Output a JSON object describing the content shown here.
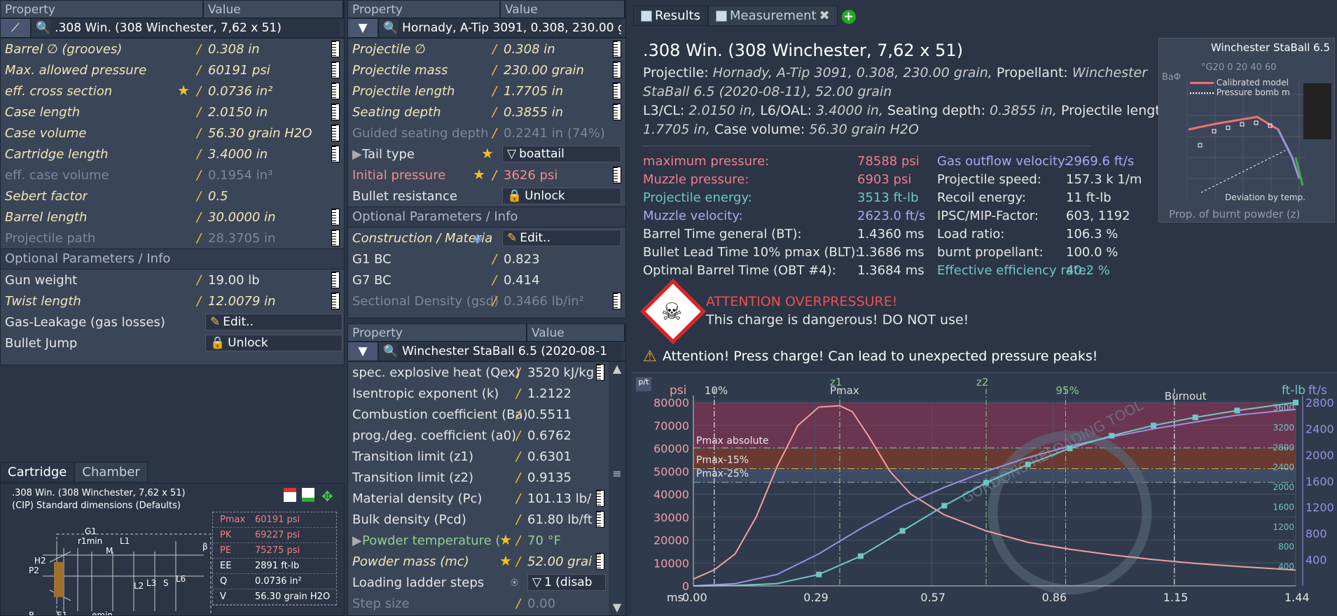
{
  "panel1": {
    "col_property": "Property",
    "col_value": "Value",
    "selector": ".308 Win. (308 Winchester, 7,62 x 51)",
    "rows": [
      {
        "k": "Barrel ∅ (grooves)",
        "v": "0.308 in"
      },
      {
        "k": "Max. allowed pressure",
        "v": "60191 psi"
      },
      {
        "k": "eff. cross section",
        "v": "0.0736 in²"
      },
      {
        "k": "Case length",
        "v": "2.0150 in"
      },
      {
        "k": "Case volume",
        "v": "56.30 grain H2O"
      },
      {
        "k": "Cartridge length",
        "v": "3.4000 in"
      },
      {
        "k": "eff. case volume",
        "v": "0.1954 in³"
      },
      {
        "k": "Sebert factor",
        "v": "0.5"
      },
      {
        "k": "Barrel length",
        "v": "30.0000 in"
      },
      {
        "k": "Projectile path",
        "v": "28.3705 in"
      }
    ],
    "section": "Optional Parameters / Info",
    "opt_rows": [
      {
        "k": "Gun weight",
        "v": "19.00 lb"
      },
      {
        "k": "Twist length",
        "v": "12.0079 in"
      },
      {
        "k": "Gas-Leakage (gas losses)",
        "v": "Edit.."
      },
      {
        "k": "Bullet Jump",
        "v": "Unlock"
      }
    ]
  },
  "cartridge": {
    "tab1": "Cartridge",
    "tab2": "Chamber",
    "line1": ".308 Win. (308 Winchester, 7,62 x 51)",
    "line2": "(CIP) Standard dimensions (Defaults)",
    "specs": [
      {
        "k": "Pmax",
        "v": "60191 psi"
      },
      {
        "k": "PK",
        "v": "69227 psi"
      },
      {
        "k": "PE",
        "v": "75275 psi"
      },
      {
        "k": "EE",
        "v": "2891 ft-lb"
      },
      {
        "k": "Q",
        "v": "0.0736 in²"
      },
      {
        "k": "V",
        "v": "56.30 grain H2O"
      }
    ],
    "dims": [
      "G1",
      "r1min",
      "L1",
      "H2",
      "P2",
      "M",
      "L2",
      "L3",
      "S",
      "L6",
      "β",
      "E1",
      "emin",
      "R"
    ]
  },
  "panel2": {
    "col_property": "Property",
    "col_value": "Value",
    "selector": "Hornady, A-Tip 3091, 0.308, 230.00 g",
    "rows": [
      {
        "k": "Projectile ∅",
        "v": "0.308 in"
      },
      {
        "k": "Projectile mass",
        "v": "230.00 grain"
      },
      {
        "k": "Projectile length",
        "v": "1.7705 in"
      },
      {
        "k": "Seating depth",
        "v": "0.3855 in"
      },
      {
        "k": "Guided seating depth",
        "v": "0.2241 in (74%)"
      },
      {
        "k": "Tail type",
        "v": "boattail"
      },
      {
        "k": "Initial pressure",
        "v": "3626 psi"
      },
      {
        "k": "Bullet resistance",
        "v": "Unlock"
      }
    ],
    "section": "Optional Parameters / Info",
    "opt_rows": [
      {
        "k": "Construction / Materia",
        "v": "Edit.."
      },
      {
        "k": "G1 BC",
        "v": "0.823"
      },
      {
        "k": "G7 BC",
        "v": "0.414"
      },
      {
        "k": "Sectional Density (gsd)",
        "v": "0.3466 lb/in²"
      }
    ]
  },
  "panel3": {
    "col_property": "Property",
    "col_value": "Value",
    "selector": "Winchester StaBall 6.5 (2020-08-1",
    "rows": [
      {
        "k": "spec. explosive heat (Qex)",
        "v": "3520 kJ/kg"
      },
      {
        "k": "Isentropic exponent (k)",
        "v": "1.2122"
      },
      {
        "k": "Combustion coefficient (Ba)",
        "v": "0.5511"
      },
      {
        "k": "prog./deg. coefficient (a0)",
        "v": "0.6762"
      },
      {
        "k": "Transition limit (z1)",
        "v": "0.6301"
      },
      {
        "k": "Transition limit (z2)",
        "v": "0.9135"
      },
      {
        "k": "Material density (Pc)",
        "v": "101.13 lb/"
      },
      {
        "k": "Bulk density (Pcd)",
        "v": "61.80 lb/ft"
      },
      {
        "k": "Powder temperature (",
        "v": "70 °F"
      },
      {
        "k": "Powder mass (mc)",
        "v": "52.00 grai"
      },
      {
        "k": "Loading ladder steps",
        "v": "1 (disab"
      },
      {
        "k": "Step size",
        "v": "0.00"
      }
    ]
  },
  "results": {
    "tab_results": "Results",
    "tab_measurement": "Measurement",
    "title": ".308 Win. (308 Winchester, 7,62 x 51)",
    "projectile_label": "Projectile:",
    "projectile": "Hornady, A-Tip 3091, 0.308, 230.00 grain,",
    "propellant_label": "Propellant:",
    "propellant": "Winchester",
    "propellant2": "StaBall 6.5 (2020-08-11), 52.00 grain",
    "l3_label": "L3/CL:",
    "l3": "2.0150 in,",
    "l6_label": "L6/OAL:",
    "l6": "3.4000 in,",
    "seat_label": "Seating depth:",
    "seat": "0.3855 in,",
    "plen_label": "Projectile length:",
    "plen": "1.7705 in,",
    "cv_label": "Case volume:",
    "cv": "56.30 grain H2O",
    "left_stats": [
      {
        "k": "maximum pressure:",
        "v": "78588 psi",
        "c": "pink"
      },
      {
        "k": "Muzzle pressure:",
        "v": "6903 psi",
        "c": "pink"
      },
      {
        "k": "Projectile energy:",
        "v": "3513 ft-lb",
        "c": "cyan"
      },
      {
        "k": "Muzzle velocity:",
        "v": "2623.0 ft/s",
        "c": "lav"
      },
      {
        "k": "Barrel Time general (BT):",
        "v": "1.4360 ms",
        "c": "norm"
      },
      {
        "k": "Bullet Lead Time 10% pmax (BLT):",
        "v": "1.3686 ms",
        "c": "norm"
      },
      {
        "k": "Optimal Barrel Time (OBT #4):",
        "v": "1.3684 ms",
        "c": "norm"
      }
    ],
    "right_stats": [
      {
        "k": "Gas outflow velocity:",
        "v": "2969.6 ft/s",
        "c": "lav"
      },
      {
        "k": "Projectile speed:",
        "v": "157.3 k 1/m",
        "c": "norm"
      },
      {
        "k": "Recoil energy:",
        "v": "11 ft-lb",
        "c": "norm"
      },
      {
        "k": "IPSC/MIP-Factor:",
        "v": "603, 1192",
        "c": "norm"
      },
      {
        "k": "Load ratio:",
        "v": "106.3 %",
        "c": "norm"
      },
      {
        "k": "burnt propellant:",
        "v": "100.0 %",
        "c": "norm"
      },
      {
        "k": "Effective efficiency rate:",
        "v": "40.2 %",
        "c": "cyan"
      }
    ],
    "warn_title": "ATTENTION OVERPRESSURE!",
    "warn_text": "This charge is dangerous! DO NOT use!",
    "attention": "Attention! Press charge! Can lead to unexpected pressure peaks!",
    "mini_title": "Winchester StaBall 6.5",
    "mini_legend1": "Calibrated model",
    "mini_legend2": "Pressure bomb m",
    "mini_legend3": "Deviation by temp.",
    "mini_xlabel": "Prop. of burnt powder (z)",
    "mini_top": "°G20  0  20 40 60",
    "mini_ylabel": "BaΦ"
  },
  "chart_data": {
    "type": "line",
    "x_unit": "ms",
    "x_ticks": [
      "0.00",
      "0.29",
      "0.57",
      "0.86",
      "1.15",
      "1.44"
    ],
    "y_left_unit": "psi",
    "y_left_ticks": [
      "0",
      "10000",
      "20000",
      "30000",
      "40000",
      "50000",
      "60000",
      "70000",
      "80000"
    ],
    "y_right1_unit": "ft-lb",
    "y_right1_ticks": [
      "400",
      "800",
      "1200",
      "1600",
      "2000",
      "2400",
      "2800",
      "3200",
      "3600"
    ],
    "y_right2_unit": "ft/s",
    "y_right2_ticks": [
      "400",
      "800",
      "1200",
      "1600",
      "2000",
      "2400",
      "2800"
    ],
    "xlim": [
      0,
      1.44
    ],
    "ylim": [
      0,
      80000
    ],
    "markers": [
      "10%",
      "Pmax",
      "z1",
      "z2",
      "95%",
      "Burnout"
    ],
    "bands": [
      "Pmax absolute",
      "Pmax-15%",
      "Pmax-25%"
    ],
    "watermark": "GORDONS RELOADING TOOL",
    "series": [
      {
        "color": "#f0a0a0",
        "x": [
          0,
          0.05,
          0.1,
          0.15,
          0.2,
          0.25,
          0.3,
          0.35,
          0.38,
          0.42,
          0.47,
          0.52,
          0.6,
          0.7,
          0.8,
          0.9,
          1.0,
          1.1,
          1.2,
          1.3,
          1.44
        ],
        "values": [
          3000,
          7000,
          14000,
          30000,
          52000,
          70000,
          78000,
          78588,
          76000,
          65000,
          50000,
          40000,
          31000,
          24000,
          19000,
          16000,
          13500,
          11500,
          9800,
          8500,
          6903
        ]
      },
      {
        "color": "#9a90e0",
        "x": [
          0,
          0.1,
          0.2,
          0.3,
          0.4,
          0.5,
          0.6,
          0.7,
          0.8,
          0.9,
          1.0,
          1.1,
          1.2,
          1.3,
          1.44
        ],
        "values": [
          0,
          1000,
          5000,
          14000,
          25000,
          35000,
          43000,
          50000,
          56000,
          61000,
          65000,
          68500,
          71500,
          74500,
          77000
        ]
      },
      {
        "color": "#6fc6c6",
        "x": [
          0,
          0.1,
          0.2,
          0.3,
          0.4,
          0.5,
          0.6,
          0.7,
          0.8,
          0.9,
          1.0,
          1.1,
          1.2,
          1.3,
          1.44
        ],
        "values": [
          0,
          200,
          1000,
          5000,
          13000,
          24000,
          35000,
          45000,
          53000,
          60000,
          65500,
          70000,
          73500,
          76500,
          80000
        ]
      }
    ]
  }
}
